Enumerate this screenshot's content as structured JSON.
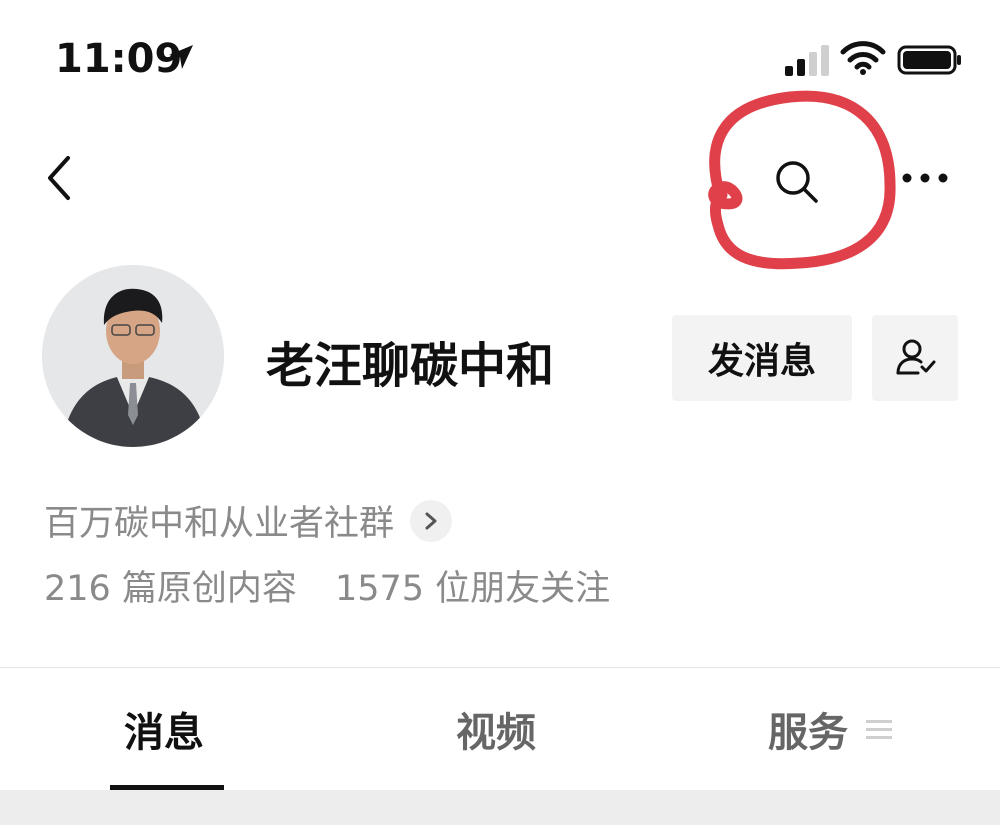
{
  "status_bar": {
    "time": "11:09",
    "icons": [
      "location-arrow-icon",
      "signal-icon",
      "wifi-icon",
      "battery-icon"
    ]
  },
  "nav": {
    "back_icon": "chevron-left-icon",
    "search_icon": "search-icon",
    "more_icon": "more-icon",
    "annotation_color": "#e0404a"
  },
  "profile": {
    "name": "老汪聊碳中和",
    "message_button": "发消息",
    "follow_icon": "user-check-icon",
    "description": "百万碳中和从业者社群",
    "stats": {
      "articles": "216 篇原创内容",
      "followers": "1575 位朋友关注"
    }
  },
  "tabs": [
    {
      "label": "消息",
      "active": true
    },
    {
      "label": "视频",
      "active": false
    },
    {
      "label": "服务",
      "active": false
    }
  ],
  "colors": {
    "text_primary": "#111111",
    "text_secondary": "#8a8a8a",
    "button_bg": "#f3f3f3"
  }
}
